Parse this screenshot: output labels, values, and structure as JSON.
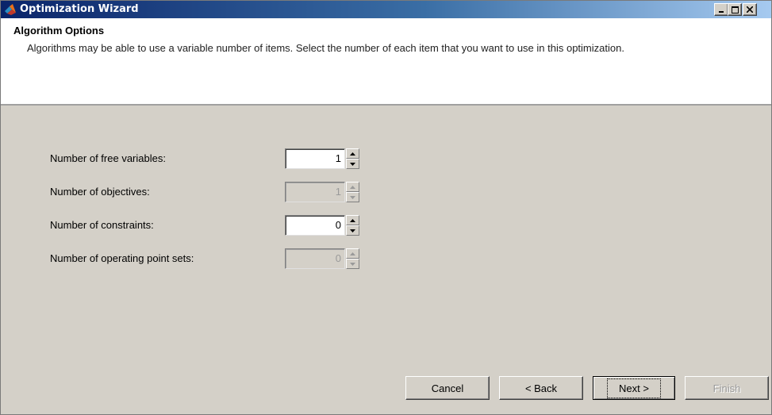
{
  "window": {
    "title": "Optimization Wizard",
    "icon": "matlab-icon",
    "controls": [
      "minimize-icon",
      "maximize-icon",
      "close-icon"
    ]
  },
  "header": {
    "title": "Algorithm Options",
    "description": "Algorithms may be able to use a variable number of items.  Select the number of each item that you want to use in this optimization."
  },
  "form": {
    "fields": [
      {
        "label": "Number of free variables:",
        "value": "1",
        "enabled": true
      },
      {
        "label": "Number of objectives:",
        "value": "1",
        "enabled": false
      },
      {
        "label": "Number of constraints:",
        "value": "0",
        "enabled": true
      },
      {
        "label": "Number of operating point sets:",
        "value": "0",
        "enabled": false
      }
    ]
  },
  "buttons": {
    "cancel": "Cancel",
    "back": "< Back",
    "next": "Next >",
    "finish": "Finish"
  },
  "colors": {
    "titlebar_start": "#0a246a",
    "titlebar_end": "#a6caf0",
    "dialog_bg": "#d4d0c8",
    "header_bg": "#ffffff",
    "disabled_text": "#9a9a9a"
  }
}
